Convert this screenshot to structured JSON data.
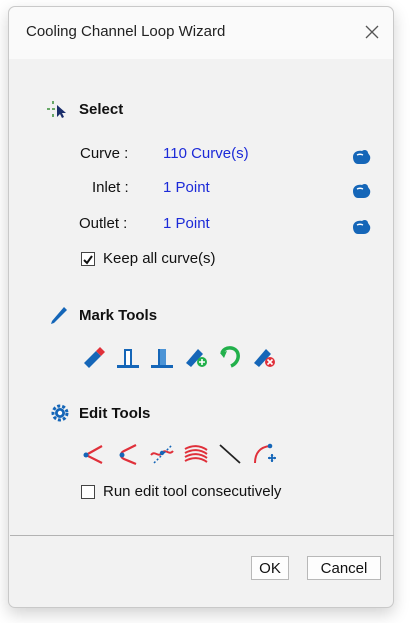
{
  "window": {
    "title": "Cooling Channel Loop Wizard"
  },
  "select": {
    "heading": "Select",
    "rows": [
      {
        "label": "Curve :",
        "value": "110 Curve(s)"
      },
      {
        "label": "Inlet :",
        "value": "1 Point"
      },
      {
        "label": "Outlet :",
        "value": "1 Point"
      }
    ],
    "keep_all": {
      "label": "Keep all curve(s)",
      "checked": true
    }
  },
  "mark_tools": {
    "heading": "Mark Tools",
    "icons": [
      "eraser-icon",
      "inlet-marker-icon",
      "outlet-marker-icon",
      "add-mark-icon",
      "loop-direction-icon",
      "delete-mark-icon"
    ]
  },
  "edit_tools": {
    "heading": "Edit Tools",
    "icons": [
      "corner-line-icon",
      "corner-arc-icon",
      "connect-curves-icon",
      "offset-curves-icon",
      "straight-line-icon",
      "move-arc-icon"
    ],
    "run_consecutively": {
      "label": "Run edit tool consecutively",
      "checked": false
    }
  },
  "buttons": {
    "ok": "OK",
    "cancel": "Cancel"
  },
  "colors": {
    "accent_blue": "#1566b8",
    "value_text": "#1c2ad8",
    "red": "#e0303a",
    "green": "#22b04b"
  }
}
